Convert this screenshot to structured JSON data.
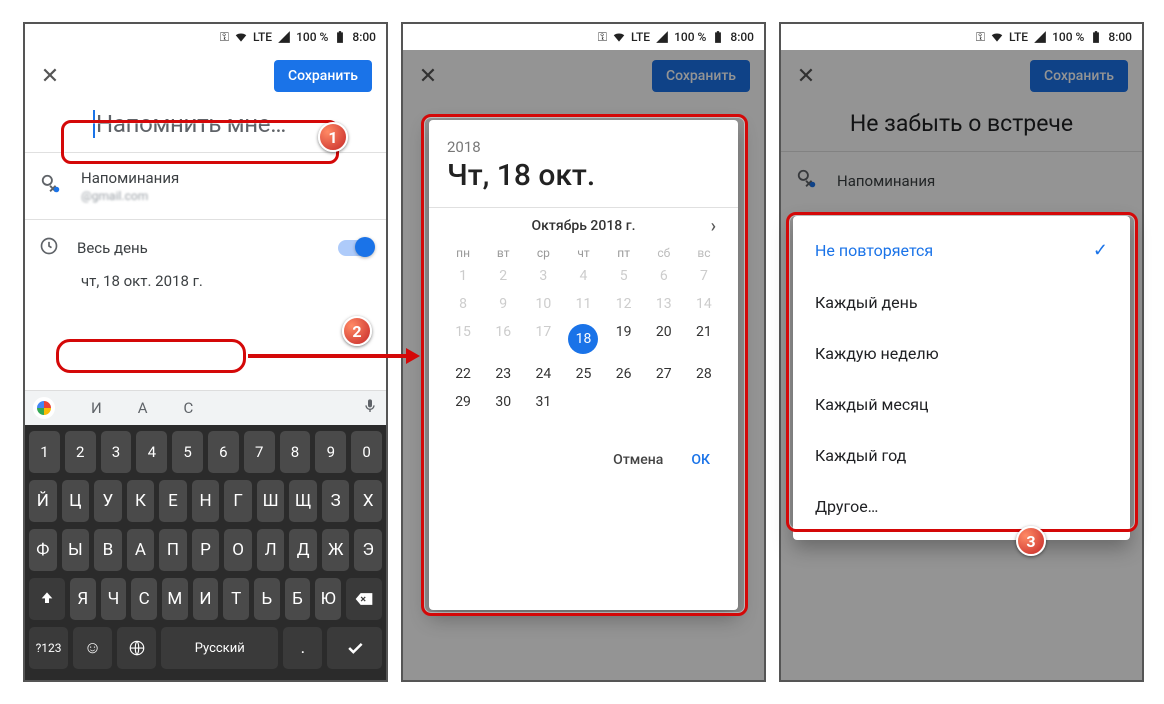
{
  "status": {
    "network": "LTE",
    "battery": "100 %",
    "time": "8:00"
  },
  "save_button": "Сохранить",
  "panel1": {
    "title_placeholder": "Напомнить мне…",
    "reminders_label": "Напоминания",
    "reminders_sub": "@gmail.com",
    "all_day": "Весь день",
    "date_text": "чт, 18 окт. 2018 г.",
    "suggestions": [
      "И",
      "А",
      "С"
    ],
    "kbd_numbers": [
      "1",
      "2",
      "3",
      "4",
      "5",
      "6",
      "7",
      "8",
      "9",
      "0"
    ],
    "kbd_row1": [
      "Й",
      "Ц",
      "У",
      "К",
      "Е",
      "Н",
      "Г",
      "Ш",
      "Щ",
      "З",
      "Х"
    ],
    "kbd_row2": [
      "Ф",
      "Ы",
      "В",
      "А",
      "П",
      "Р",
      "О",
      "Л",
      "Д",
      "Ж",
      "Э"
    ],
    "kbd_row3": [
      "Я",
      "Ч",
      "С",
      "М",
      "И",
      "Т",
      "Ь",
      "Б",
      "Ю"
    ],
    "kbd_sym": "?123",
    "kbd_lang": "Русский"
  },
  "panel2": {
    "year": "2018",
    "big_date": "Чт, 18 окт.",
    "month_label": "Октябрь 2018 г.",
    "dow": [
      "пн",
      "вт",
      "ср",
      "чт",
      "пт",
      "сб",
      "вс"
    ],
    "days_dim": [
      1,
      2,
      3,
      4,
      5,
      6,
      7,
      8,
      9,
      10,
      11,
      12,
      13,
      14
    ],
    "days_current_row3": [
      15,
      16,
      17,
      18,
      19,
      20,
      21
    ],
    "days_current_row4": [
      22,
      23,
      24,
      25,
      26,
      27,
      28
    ],
    "days_current_row5": [
      29,
      30,
      31
    ],
    "selected_day": 18,
    "cancel": "Отмена",
    "ok": "ОК"
  },
  "panel3": {
    "title_text": "Не забыть о встрече",
    "reminders_label": "Напоминания",
    "options": [
      "Не повторяется",
      "Каждый день",
      "Каждую неделю",
      "Каждый месяц",
      "Каждый год",
      "Другое…"
    ],
    "selected_index": 0
  }
}
